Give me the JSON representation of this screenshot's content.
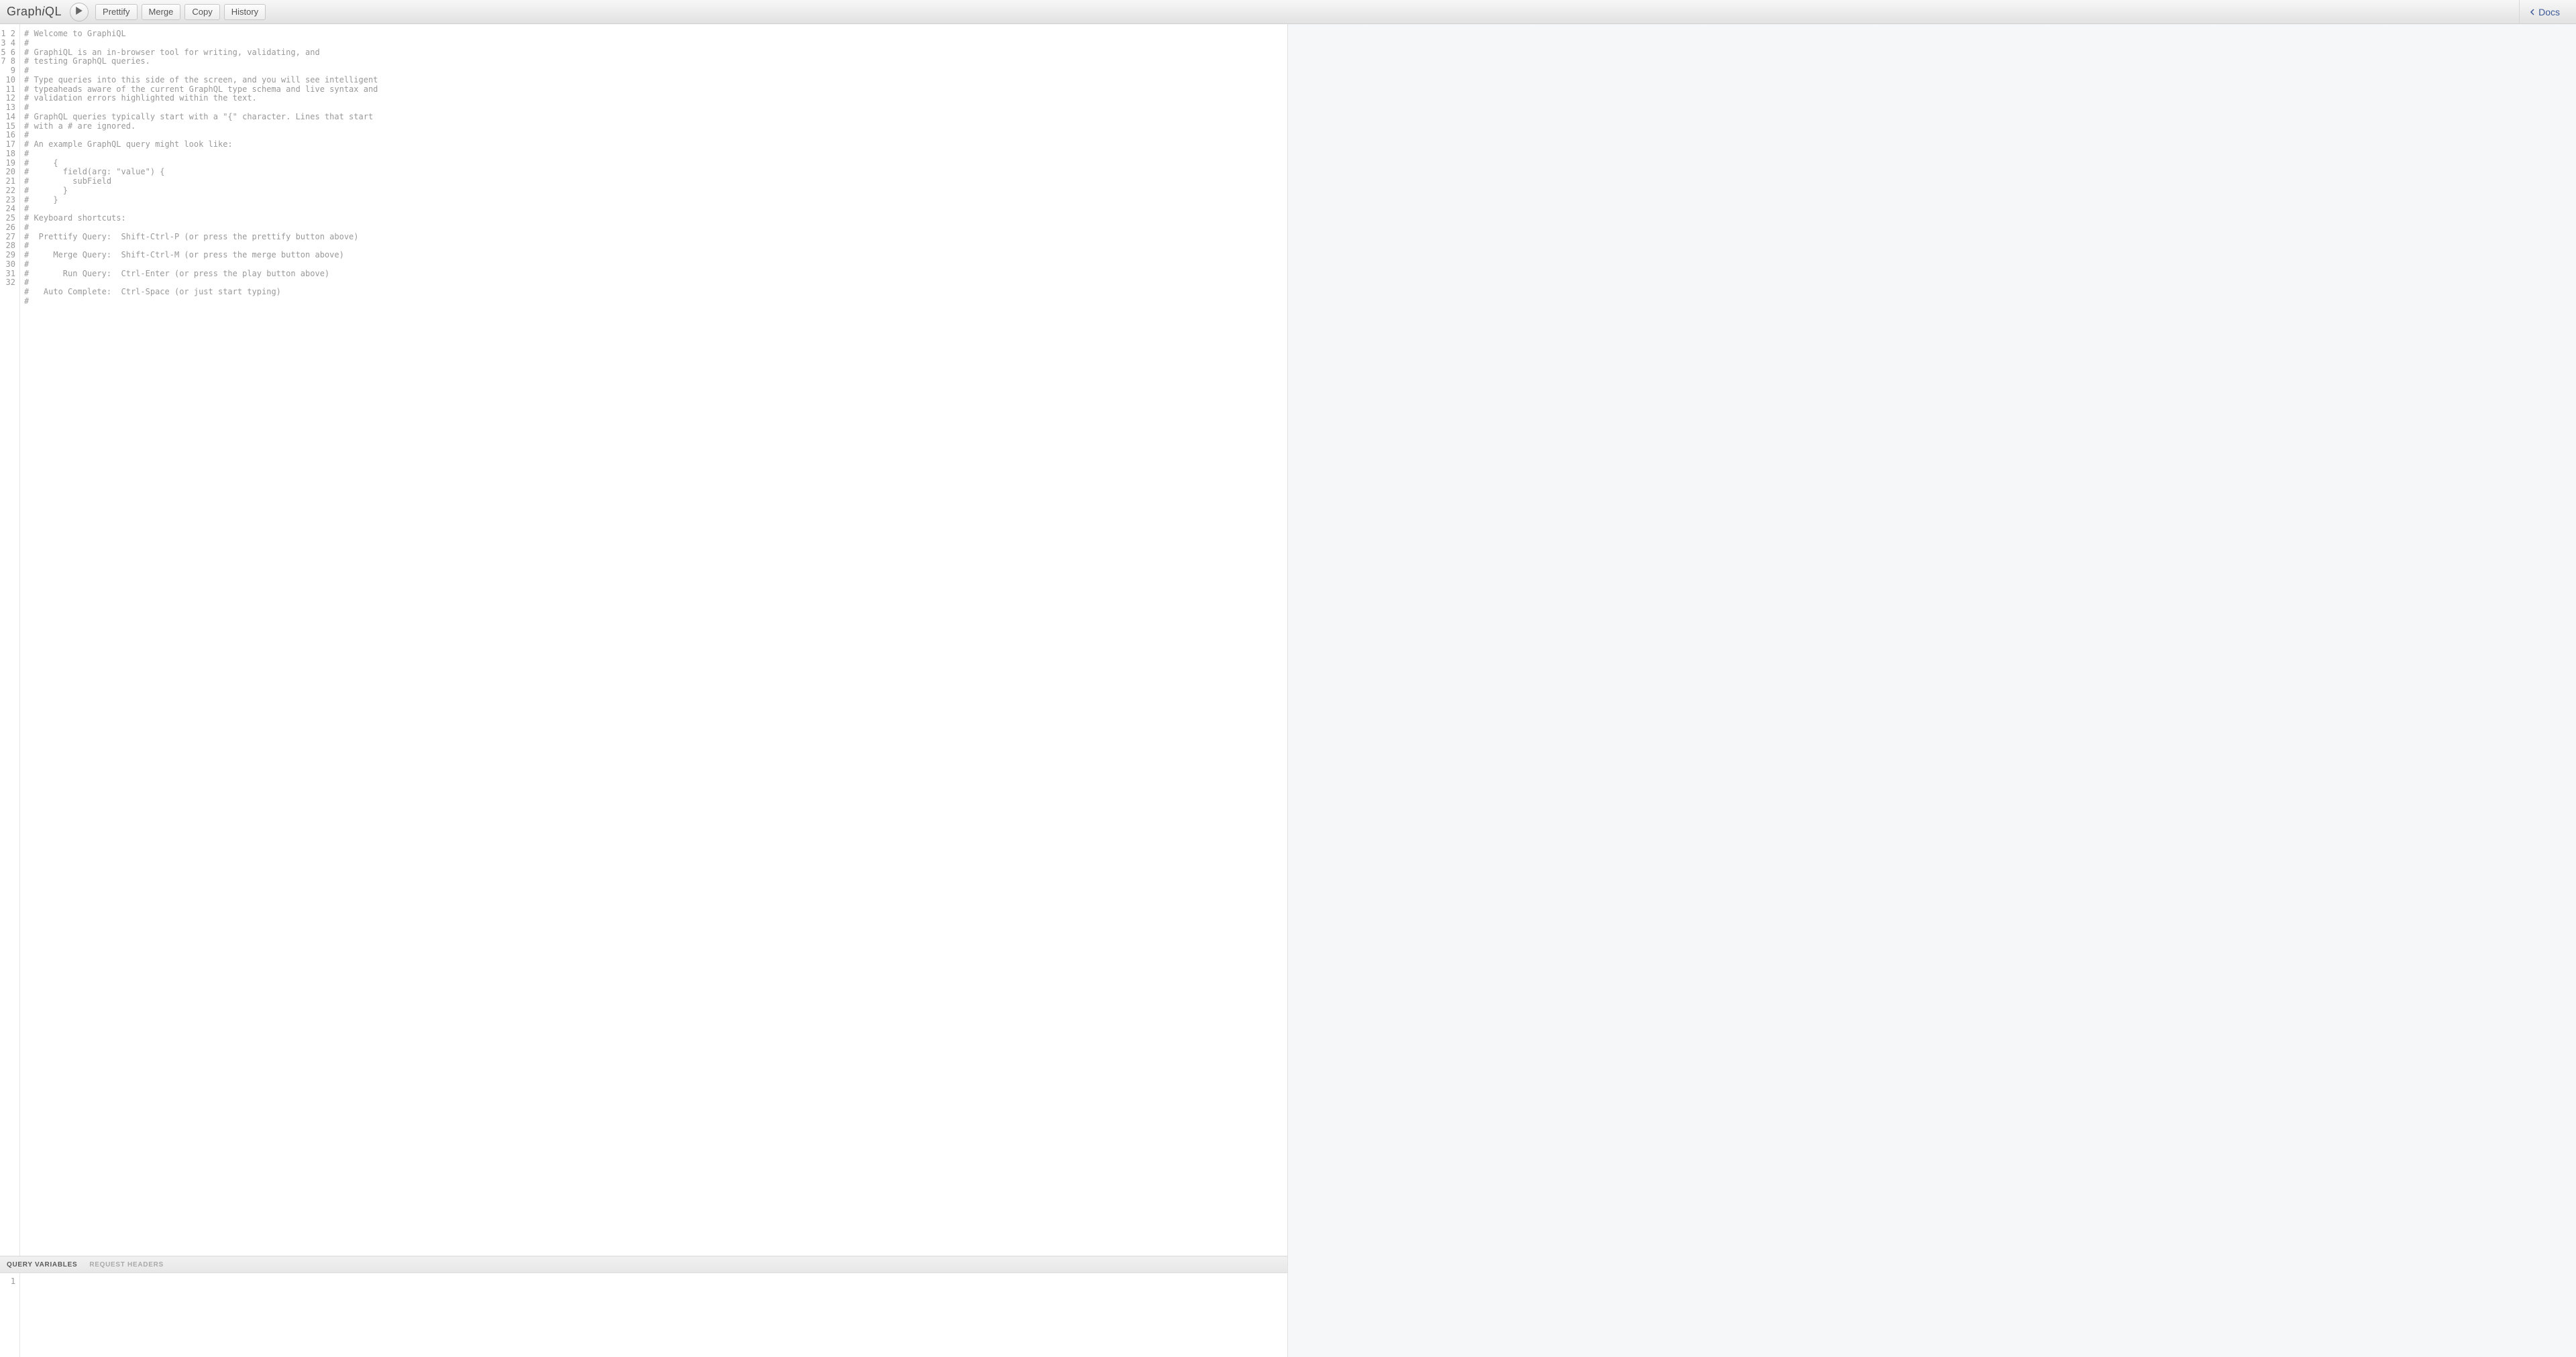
{
  "header": {
    "title_prefix": "Graph",
    "title_i": "i",
    "title_suffix": "QL",
    "buttons": {
      "prettify": "Prettify",
      "merge": "Merge",
      "copy": "Copy",
      "history": "History"
    },
    "docs": "Docs"
  },
  "editor": {
    "line_count": 32,
    "lines": [
      "# Welcome to GraphiQL",
      "#",
      "# GraphiQL is an in-browser tool for writing, validating, and",
      "# testing GraphQL queries.",
      "#",
      "# Type queries into this side of the screen, and you will see intelligent",
      "# typeaheads aware of the current GraphQL type schema and live syntax and",
      "# validation errors highlighted within the text.",
      "#",
      "# GraphQL queries typically start with a \"{\" character. Lines that start",
      "# with a # are ignored.",
      "#",
      "# An example GraphQL query might look like:",
      "#",
      "#     {",
      "#       field(arg: \"value\") {",
      "#         subField",
      "#       }",
      "#     }",
      "#",
      "# Keyboard shortcuts:",
      "#",
      "#  Prettify Query:  Shift-Ctrl-P (or press the prettify button above)",
      "#",
      "#     Merge Query:  Shift-Ctrl-M (or press the merge button above)",
      "#",
      "#       Run Query:  Ctrl-Enter (or press the play button above)",
      "#",
      "#   Auto Complete:  Ctrl-Space (or just start typing)",
      "#",
      "",
      ""
    ]
  },
  "secondary": {
    "tabs": {
      "query_variables": "Query Variables",
      "request_headers": "Request Headers"
    },
    "line_count": 1,
    "content": ""
  }
}
